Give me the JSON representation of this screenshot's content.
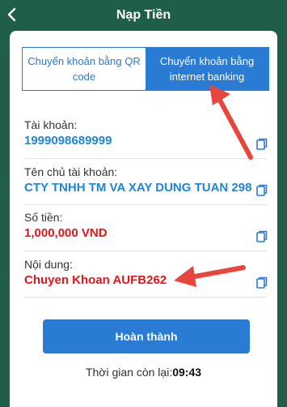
{
  "header": {
    "title": "Nạp Tiền",
    "back_icon": "chevron-left-icon"
  },
  "tabs": [
    {
      "label": "Chuyển khoản bằng QR code",
      "active": false
    },
    {
      "label": "Chuyển khoản bằng internet banking",
      "active": true
    }
  ],
  "fields": {
    "account": {
      "label": "Tài khoản:",
      "value": "1999098689999"
    },
    "owner": {
      "label": "Tên chủ tài khoản:",
      "value": "CTY TNHH TM VA XAY DUNG TUAN 298"
    },
    "amount": {
      "label": "Số tiền:",
      "value": "1,000,000 VND"
    },
    "content": {
      "label": "Nội dung:",
      "value": "Chuyen Khoan AUFB262"
    }
  },
  "copy_icon": "copy-icon",
  "done_button": {
    "label": "Hoàn thành"
  },
  "timer": {
    "label": "Thời gian còn lại:",
    "value": "09:43"
  },
  "colors": {
    "header_bg": "#1f5f4a",
    "accent": "#2a7bd4",
    "value_blue": "#1f86d6",
    "value_red": "#e3161b",
    "annotation_arrow": "#e8453c"
  }
}
